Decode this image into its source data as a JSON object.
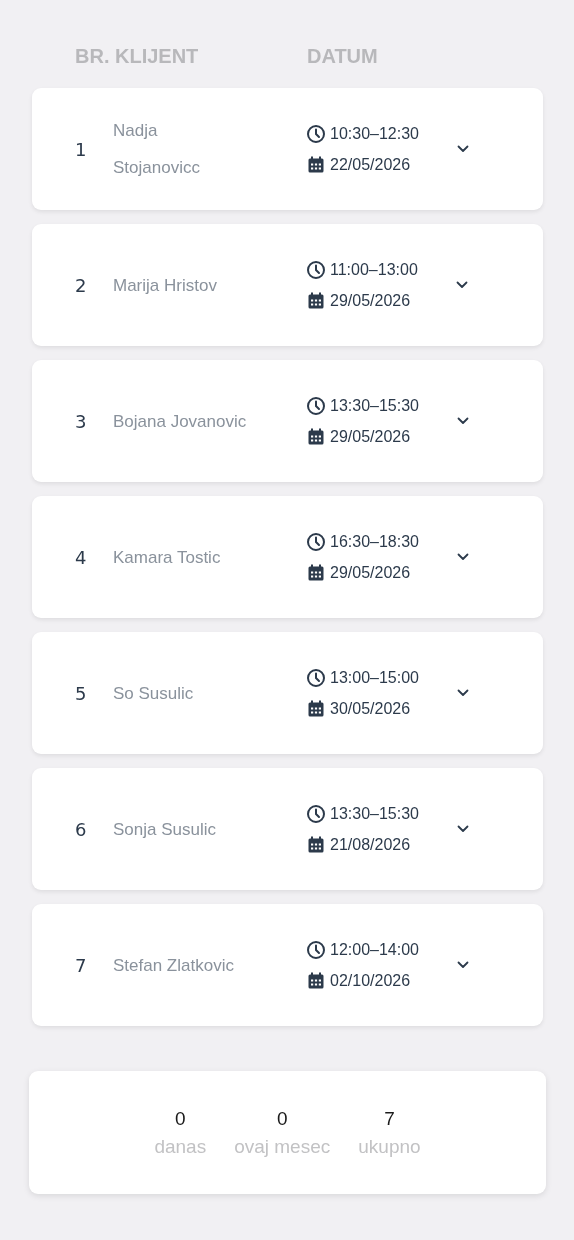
{
  "columns": [
    "BR.",
    "KLIJENT",
    "DATUM"
  ],
  "rows": [
    {
      "number": "1",
      "client": "Nadja Stojanovicc",
      "time": "10:30–12:30",
      "date": "22/05/2026",
      "expanded": false
    },
    {
      "number": "2",
      "client": "Marija Hristov",
      "time": "11:00–13:00",
      "date": "29/05/2026",
      "expanded": false
    },
    {
      "number": "3",
      "client": "Bojana Jovanovic",
      "time": "13:30–15:30",
      "date": "29/05/2026",
      "expanded": false
    },
    {
      "number": "4",
      "client": "Kamara Tostic",
      "time": "16:30–18:30",
      "date": "29/05/2026",
      "expanded": false
    },
    {
      "number": "5",
      "client": "So Susulic",
      "time": "13:00–15:00",
      "date": "30/05/2026",
      "expanded": false
    },
    {
      "number": "6",
      "client": "Sonja Susulic",
      "time": "13:30–15:30",
      "date": "21/08/2026",
      "expanded": false
    },
    {
      "number": "7",
      "client": "Stefan Zlatkovic",
      "time": "12:00–14:00",
      "date": "02/10/2026",
      "expanded": false
    }
  ],
  "summary": [
    {
      "value": "0",
      "label": "danas"
    },
    {
      "value": "0",
      "label": "ovaj mesec"
    },
    {
      "value": "7",
      "label": "ukupno"
    }
  ]
}
